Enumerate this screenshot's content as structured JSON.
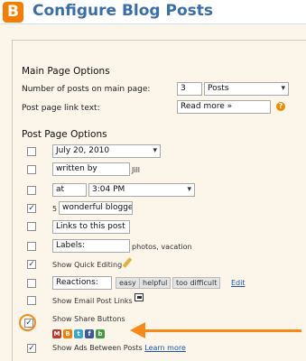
{
  "header": {
    "logo_letter": "B",
    "title": "Configure Blog Posts"
  },
  "main_page": {
    "title": "Main Page Options",
    "posts_label": "Number of posts on main page:",
    "posts_value": "3",
    "posts_unit": "Posts",
    "link_text_label": "Post page link text:",
    "link_text_value": "Read more »"
  },
  "post_page": {
    "title": "Post Page Options",
    "date_value": "July 20, 2010",
    "author_prefix": "written by",
    "author_name": "Jill",
    "time_prefix": "at",
    "time_value": "3:04 PM",
    "comments_count": "5",
    "comments_label": "wonderful bloggers",
    "links_label": "Links to this post",
    "labels_prefix": "Labels:",
    "labels_value": "photos, vacation",
    "quick_edit": "Show Quick Editing",
    "reactions_prefix": "Reactions:",
    "reactions": [
      "easy",
      "helpful",
      "too difficult"
    ],
    "reactions_edit": "Edit",
    "email_links": "Show Email Post Links",
    "share_buttons": "Show Share Buttons",
    "ads_between": "Show Ads Between Posts",
    "learn_more": "Learn more"
  },
  "checkboxes": {
    "date": false,
    "author": false,
    "time": false,
    "comments": true,
    "backlinks": false,
    "labels": false,
    "quick_edit": true,
    "reactions": false,
    "email_links": false,
    "share_buttons": true,
    "ads": true
  },
  "share_icons": [
    "email-icon",
    "blogger-icon",
    "twitter-icon",
    "facebook-icon",
    "buzz-icon"
  ],
  "colors": {
    "accent": "#f58a18",
    "link": "#1a55b5",
    "title_blue": "#3a6ea8"
  }
}
